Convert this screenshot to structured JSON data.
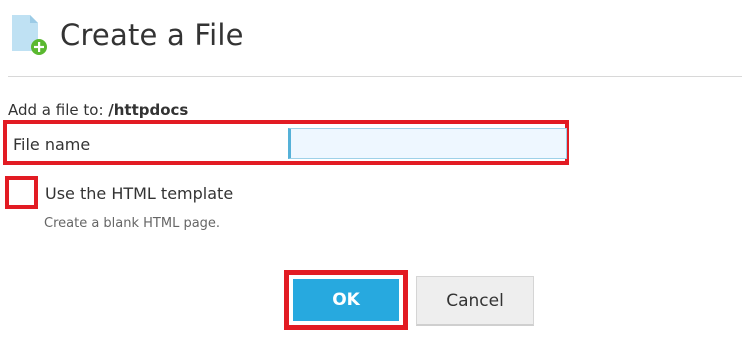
{
  "dialog": {
    "title": "Create a File",
    "icon": "file-add-icon",
    "target_label": "Add a file to: ",
    "target_path": "/httpdocs"
  },
  "form": {
    "filename_label": "File name",
    "filename_value": "",
    "template_checkbox_label": "Use the HTML template",
    "template_checkbox_checked": false,
    "template_hint": "Create a blank HTML page."
  },
  "actions": {
    "ok_label": "OK",
    "cancel_label": "Cancel"
  },
  "colors": {
    "highlight": "#e21b23",
    "primary_button": "#27a9df",
    "input_bg": "#eef7ff",
    "input_border": "#55b1d8"
  }
}
